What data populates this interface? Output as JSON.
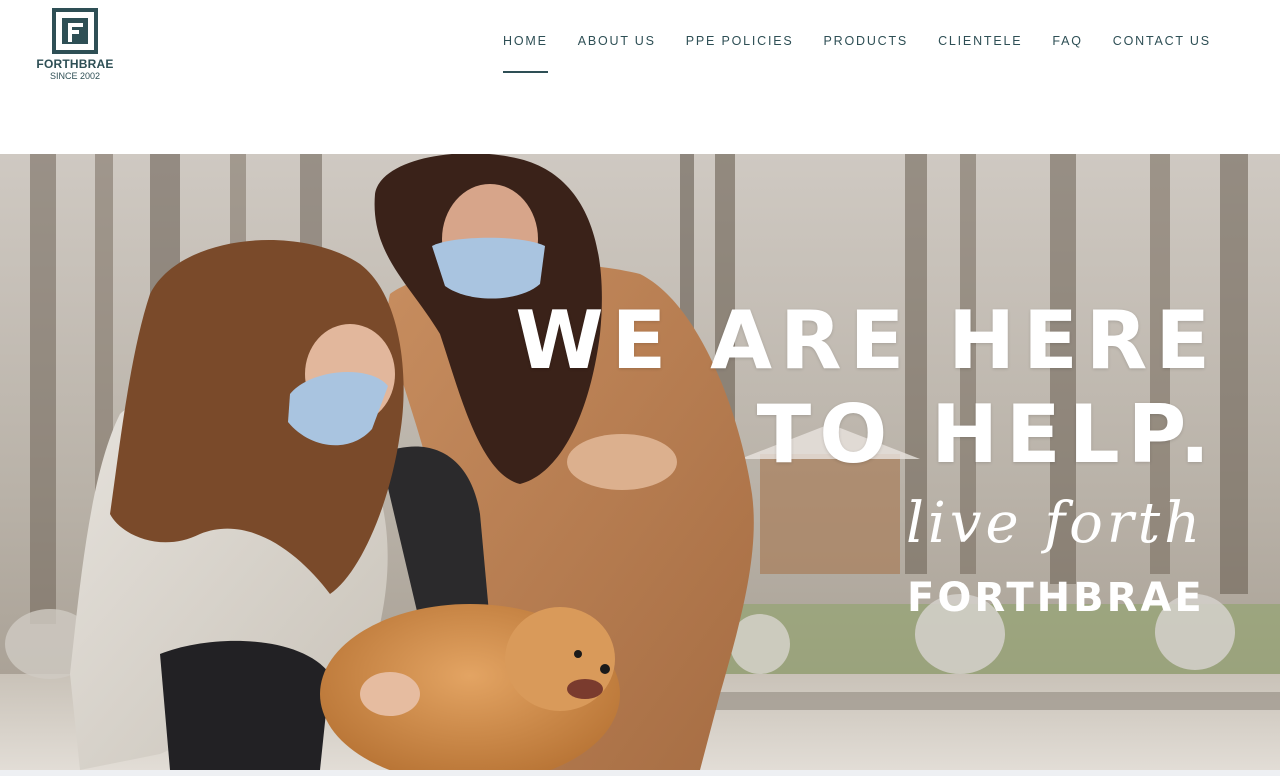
{
  "logo": {
    "name": "FORTHBRAE",
    "since": "SINCE 2002",
    "brand_color": "#2e4f55"
  },
  "nav": {
    "items": [
      {
        "label": "HOME",
        "active": true
      },
      {
        "label": "ABOUT US",
        "active": false
      },
      {
        "label": "PPE POLICIES",
        "active": false
      },
      {
        "label": "PRODUCTS",
        "active": false
      },
      {
        "label": "CLIENTELE",
        "active": false
      },
      {
        "label": "FAQ",
        "active": false
      },
      {
        "label": "CONTACT US",
        "active": false
      }
    ]
  },
  "hero": {
    "headline_line1": "WE ARE HERE",
    "headline_line2": "TO HELP.",
    "tagline_script": "live forth",
    "tagline_brand": "FORTHBRAE",
    "text_color": "#ffffff"
  }
}
